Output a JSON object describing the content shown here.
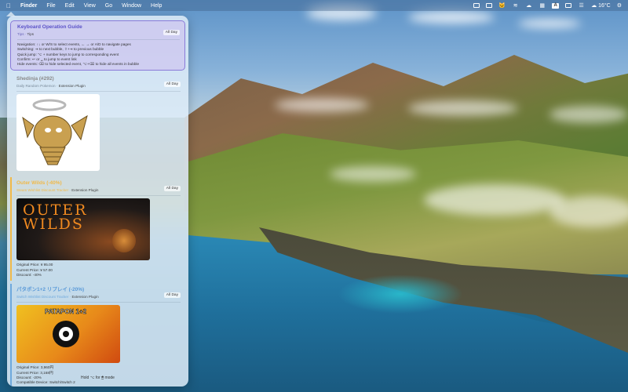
{
  "menubar": {
    "apple": "",
    "app_name": "Finder",
    "menus": [
      "File",
      "Edit",
      "View",
      "Go",
      "Window",
      "Help"
    ],
    "status_icons": [
      "display-icon",
      "battery-icon",
      "cat-icon",
      "wifi-icon",
      "cloud-icon",
      "control-center-icon",
      "input-method-icon",
      "screen-icon",
      "menu-icon"
    ],
    "input_method_label": "A",
    "weather": "☁ 16°C",
    "control_center": "⚙"
  },
  "panel": {
    "cards": [
      {
        "title": "Keyboard Operation Guide",
        "source": "Tips",
        "sub": "Tips",
        "badge": "All Day",
        "lines": [
          "Navigation: ↑↓ or W/S to select events, ← → or A/D to navigate pages",
          "Switching: ⇥ to next bubble, ⇧+⇥ to previous bubble",
          "Quick jump: ⌥ + number keys to jump to corresponding event",
          "Confirm: ↩ or ␣ to jump to event link",
          "Hide events: ⌫ to hide selected event, ⌥+⌫ to hide all events in bubble"
        ]
      },
      {
        "title": "Shedinja (#292)",
        "source": "Daily Random Pokemon",
        "sub": "Extension Plugin",
        "badge": "All Day"
      },
      {
        "title": "Outer Wilds (-40%)",
        "source": "Steam Wishlist Discount Tracker",
        "sub": "Extension Plugin",
        "badge": "All Day",
        "image_text": "OUTER WILDS",
        "lines": [
          "Original Price: ¥ 95.00",
          "Current Price: ¥ 57.00",
          "Discount: -40%"
        ]
      },
      {
        "title": "パタポン1+2 リプレイ (-20%)",
        "source": "Switch Wishlist Discount Tracker",
        "sub": "Extension Plugin",
        "badge": "All Day",
        "image_text": "PATAPON 1+2",
        "lines": [
          "Original Price: 3,960円",
          "Current Price: 3,168円",
          "Discount: -20%",
          "Compatible Device: Switch/Switch 2"
        ]
      }
    ],
    "footer": "Hold ⌥ for 🖱 mode"
  },
  "colors": {
    "accent_purple": "#5b52c8",
    "steam_orange": "#f0b94a",
    "switch_blue": "#5b9ad8"
  }
}
